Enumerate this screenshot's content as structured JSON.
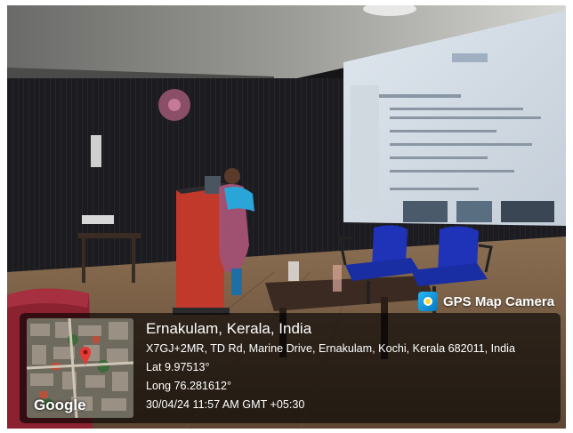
{
  "overlay": {
    "brand": "GPS Map Camera",
    "brand_icon": "gps-map-camera-icon",
    "map_label": "Google",
    "place": "Ernakulam, Kerala, India",
    "address": "X7GJ+2MR, TD Rd, Marine Drive, Ernakulam, Kochi, Kerala 682011, India",
    "lat": "Lat 9.97513°",
    "long": "Long 76.281612°",
    "datetime": "30/04/24 11:57 AM GMT +05:30"
  }
}
